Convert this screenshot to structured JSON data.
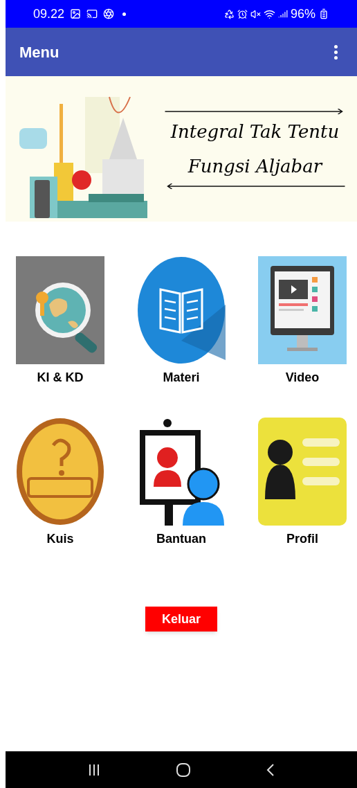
{
  "status_bar": {
    "time": "09.22",
    "battery": "96%"
  },
  "app_bar": {
    "title": "Menu"
  },
  "banner": {
    "title_lines": [
      "Integral Tak Tentu",
      "Fungsi Aljabar"
    ]
  },
  "menu_items": [
    {
      "label": "KI & KD",
      "kind": "globe"
    },
    {
      "label": "Materi",
      "kind": "book"
    },
    {
      "label": "Video",
      "kind": "monitor"
    },
    {
      "label": "Kuis",
      "kind": "quiz"
    },
    {
      "label": "Bantuan",
      "kind": "support"
    },
    {
      "label": "Profil",
      "kind": "profile"
    }
  ],
  "exit_button": {
    "label": "Keluar"
  }
}
